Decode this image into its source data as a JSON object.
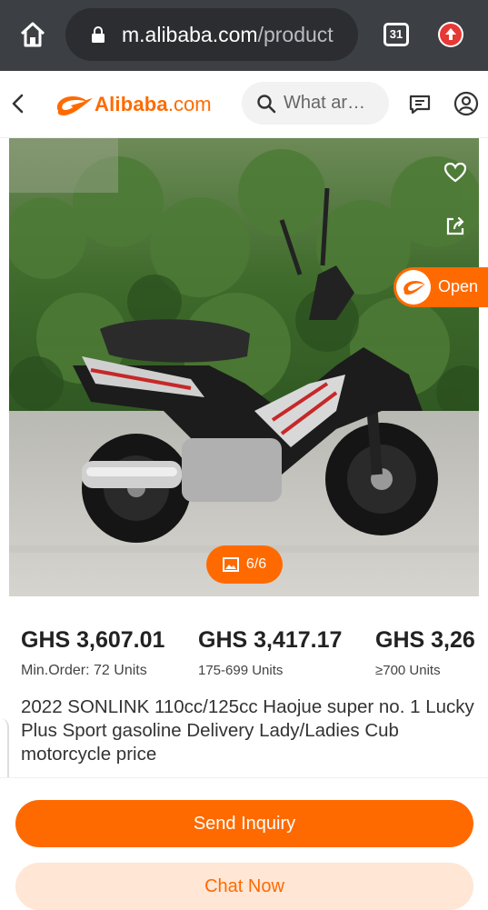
{
  "browser": {
    "url_host": "m.alibaba.com",
    "url_path": "/product",
    "tab_count": "31"
  },
  "header": {
    "logo_word": "Alibaba",
    "logo_suffix": ".com",
    "search_placeholder": "What ar…"
  },
  "gallery": {
    "counter": "6/6",
    "open_label": "Open"
  },
  "price_tiers": [
    {
      "price": "GHS 3,607.01",
      "units": "Min.Order: 72 Units"
    },
    {
      "price": "GHS 3,417.17",
      "units": "175-699 Units"
    },
    {
      "price": "GHS 3,26",
      "units": "≥700 Units"
    }
  ],
  "product": {
    "title": "2022 SONLINK 110cc/125cc Haojue super no. 1 Lucky Plus Sport gasoline Delivery Lady/Ladies Cub motorcycle price"
  },
  "actions": {
    "inquiry_label": "Send Inquiry",
    "chat_label": "Chat Now"
  },
  "colors": {
    "brand": "#ff6a00",
    "chrome": "#3c3f43"
  },
  "icons": [
    "home-icon",
    "lock-icon",
    "tabs-icon",
    "update-icon",
    "back-icon",
    "search-icon",
    "message-icon",
    "user-icon",
    "heart-icon",
    "share-icon",
    "image-icon"
  ]
}
